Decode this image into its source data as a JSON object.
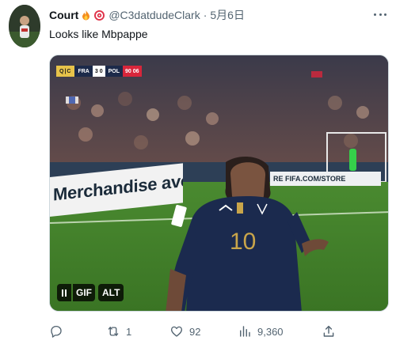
{
  "tweet": {
    "display_name": "Court",
    "badges": [
      "fire-emoji",
      "target-emoji"
    ],
    "handle": "@C3datdudeClark",
    "separator": "·",
    "date": "5月6日",
    "text": "Looks like Mbpappe"
  },
  "media": {
    "type": "gif",
    "scorebug": {
      "logo": "Q|C",
      "team_left": "FRA",
      "score": "3 0",
      "team_right": "POL",
      "time": "90 06"
    },
    "ad_board_text": "Merchandise avo",
    "ad_board_right_text": "RE  FIFA.COM/STORE",
    "pause_label": "II",
    "gif_label": "GIF",
    "alt_label": "ALT",
    "colors": {
      "pitch": "#3f7a2a",
      "jersey": "#1b2a4e",
      "crowd": "#5a4a48"
    }
  },
  "actions": {
    "reply": {
      "icon": "reply-icon",
      "count": ""
    },
    "retweet": {
      "icon": "retweet-icon",
      "count": "1"
    },
    "like": {
      "icon": "heart-icon",
      "count": "92"
    },
    "views": {
      "icon": "views-icon",
      "count": "9,360"
    },
    "share": {
      "icon": "share-icon",
      "count": ""
    }
  },
  "colors": {
    "text": "#0f1419",
    "secondary": "#536471",
    "border": "#cfd9de"
  }
}
